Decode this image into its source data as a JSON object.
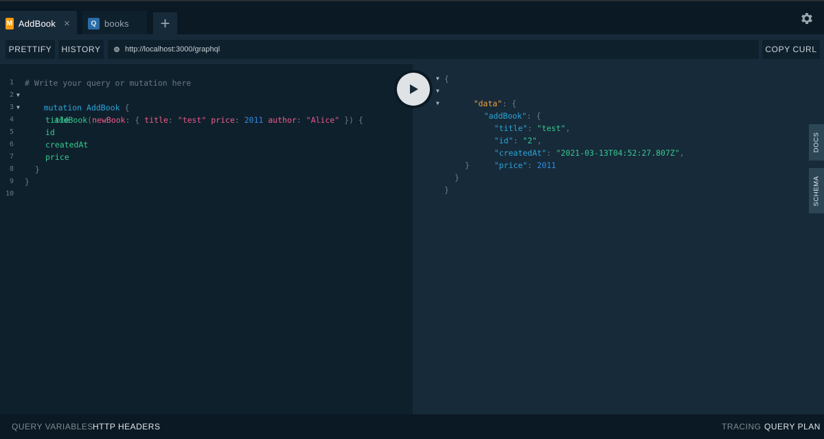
{
  "tabs": [
    {
      "badge": "M",
      "badge_color": "#f39c12",
      "label": "AddBook",
      "active": true,
      "close": "×"
    },
    {
      "badge": "Q",
      "badge_color": "#2a6ca8",
      "label": "books",
      "active": false
    }
  ],
  "add_tab_icon": "+",
  "settings_icon": "gear-icon",
  "toolbar": {
    "prettify_label": "PRETTIFY",
    "history_label": "HISTORY",
    "endpoint_url": "http://localhost:3000/graphql",
    "copy_curl_label": "COPY CURL"
  },
  "query_editor": {
    "line_numbers": [
      "1",
      "2",
      "3",
      "4",
      "5",
      "6",
      "7",
      "8",
      "9",
      "10"
    ],
    "comment": "# Write your query or mutation here",
    "keyword_mutation": "mutation",
    "operation_name": "AddBook",
    "open_brace": "{",
    "field_addBook": "addBook",
    "arg_newBook": "newBook",
    "arg_title": "title",
    "val_title": "\"test\"",
    "arg_price": "price",
    "val_price": "2011",
    "arg_author": "author",
    "val_author": "\"Alice\"",
    "close_args": "}) {",
    "fields": [
      "title",
      "id",
      "createdAt",
      "price"
    ],
    "close_brace": "}"
  },
  "result": {
    "key_data": "\"data\"",
    "key_addBook": "\"addBook\"",
    "key_title": "\"title\"",
    "val_title": "\"test\"",
    "key_id": "\"id\"",
    "val_id": "\"2\"",
    "key_createdAt": "\"createdAt\"",
    "val_createdAt": "\"2021-03-13T04:52:27.807Z\"",
    "key_price": "\"price\"",
    "val_price": "2011"
  },
  "side_tabs": {
    "docs_label": "DOCS",
    "schema_label": "SCHEMA"
  },
  "bottom": {
    "query_variables_label": "QUERY VARIABLES",
    "http_headers_label": "HTTP HEADERS",
    "tracing_label": "TRACING",
    "query_plan_label": "QUERY PLAN"
  },
  "colors": {
    "background": "#0f202d",
    "panel": "#172a3a",
    "header": "#0b1924"
  }
}
